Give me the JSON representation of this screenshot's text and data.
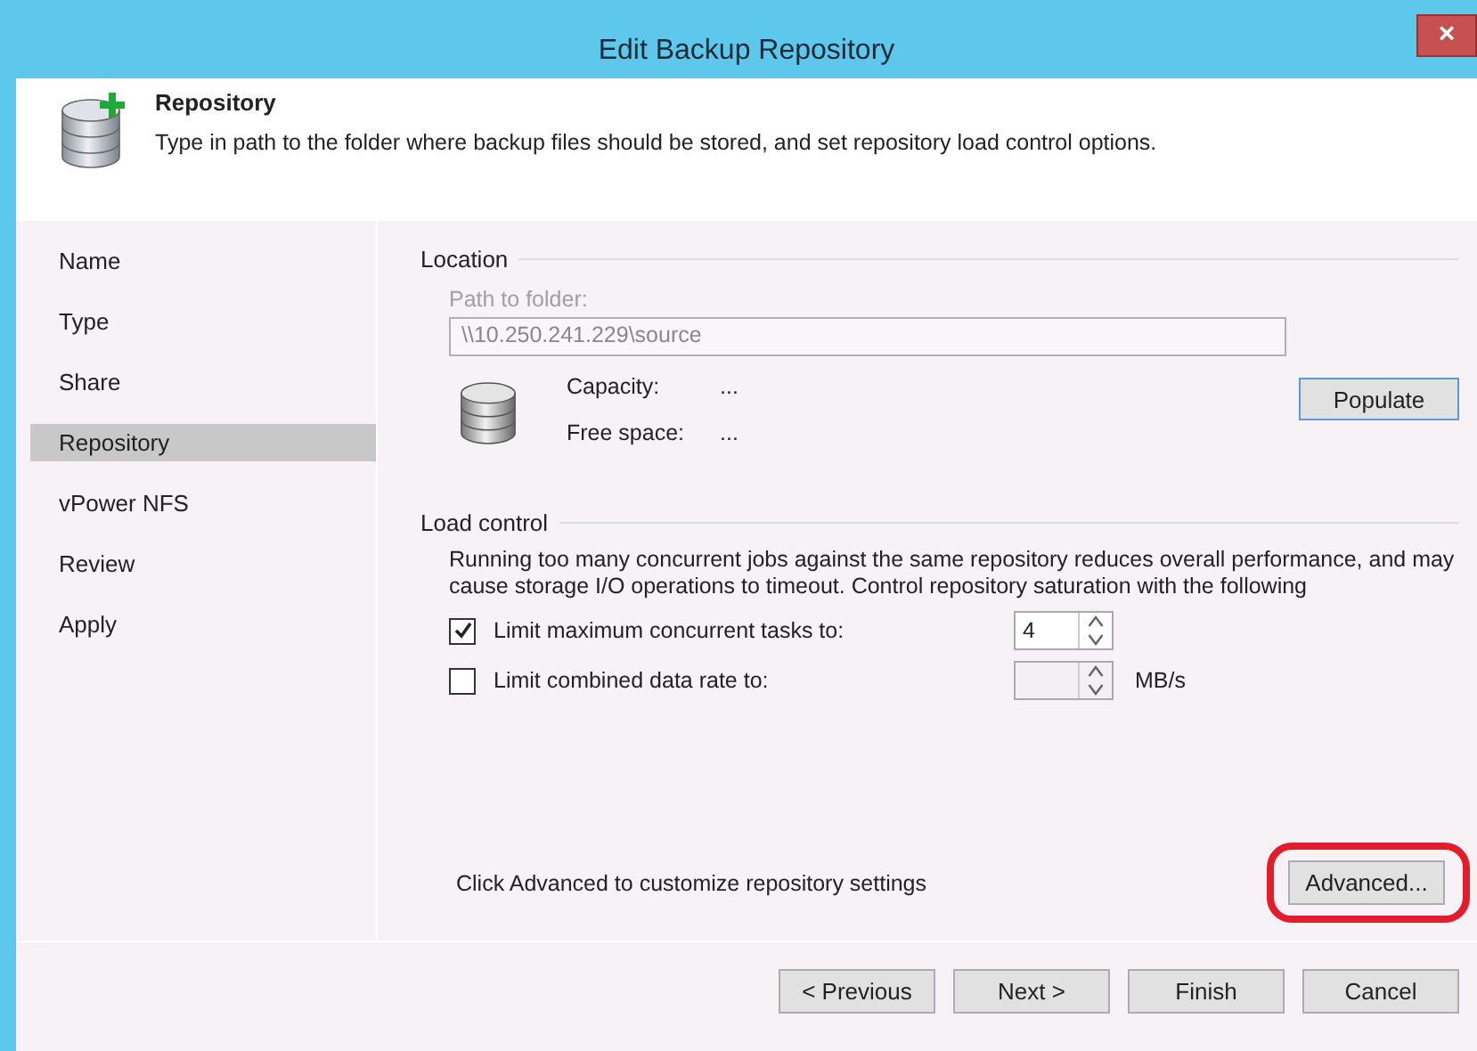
{
  "window": {
    "title": "Edit Backup Repository",
    "close": "×"
  },
  "header": {
    "title": "Repository",
    "description": "Type in path to the folder where backup files should be stored, and set repository load control options."
  },
  "sidebar": {
    "items": [
      {
        "label": "Name",
        "selected": false
      },
      {
        "label": "Type",
        "selected": false
      },
      {
        "label": "Share",
        "selected": false
      },
      {
        "label": "Repository",
        "selected": true
      },
      {
        "label": "vPower NFS",
        "selected": false
      },
      {
        "label": "Review",
        "selected": false
      },
      {
        "label": "Apply",
        "selected": false
      }
    ]
  },
  "location": {
    "heading": "Location",
    "path_label": "Path to folder:",
    "path_value": "\\\\10.250.241.229\\source",
    "path_disabled": true,
    "capacity_label": "Capacity:",
    "capacity_value": "...",
    "free_label": "Free space:",
    "free_value": "...",
    "populate_button": "Populate"
  },
  "load_control": {
    "heading": "Load control",
    "description": "Running too many concurrent jobs against the same repository reduces overall performance, and may cause storage I/O operations to timeout. Control repository saturation with the following",
    "limits": [
      {
        "label": "Limit maximum concurrent tasks to:",
        "checked": true,
        "value": "4"
      },
      {
        "label": "Limit combined data rate to:",
        "checked": false,
        "unit": "MB/s"
      }
    ]
  },
  "advanced": {
    "hint": "Click Advanced to customize repository settings",
    "button": "Advanced...",
    "highlighted": true
  },
  "buttons": [
    {
      "label": "< Previous"
    },
    {
      "label": "Next >"
    },
    {
      "label": "Finish"
    },
    {
      "label": "Cancel"
    }
  ]
}
